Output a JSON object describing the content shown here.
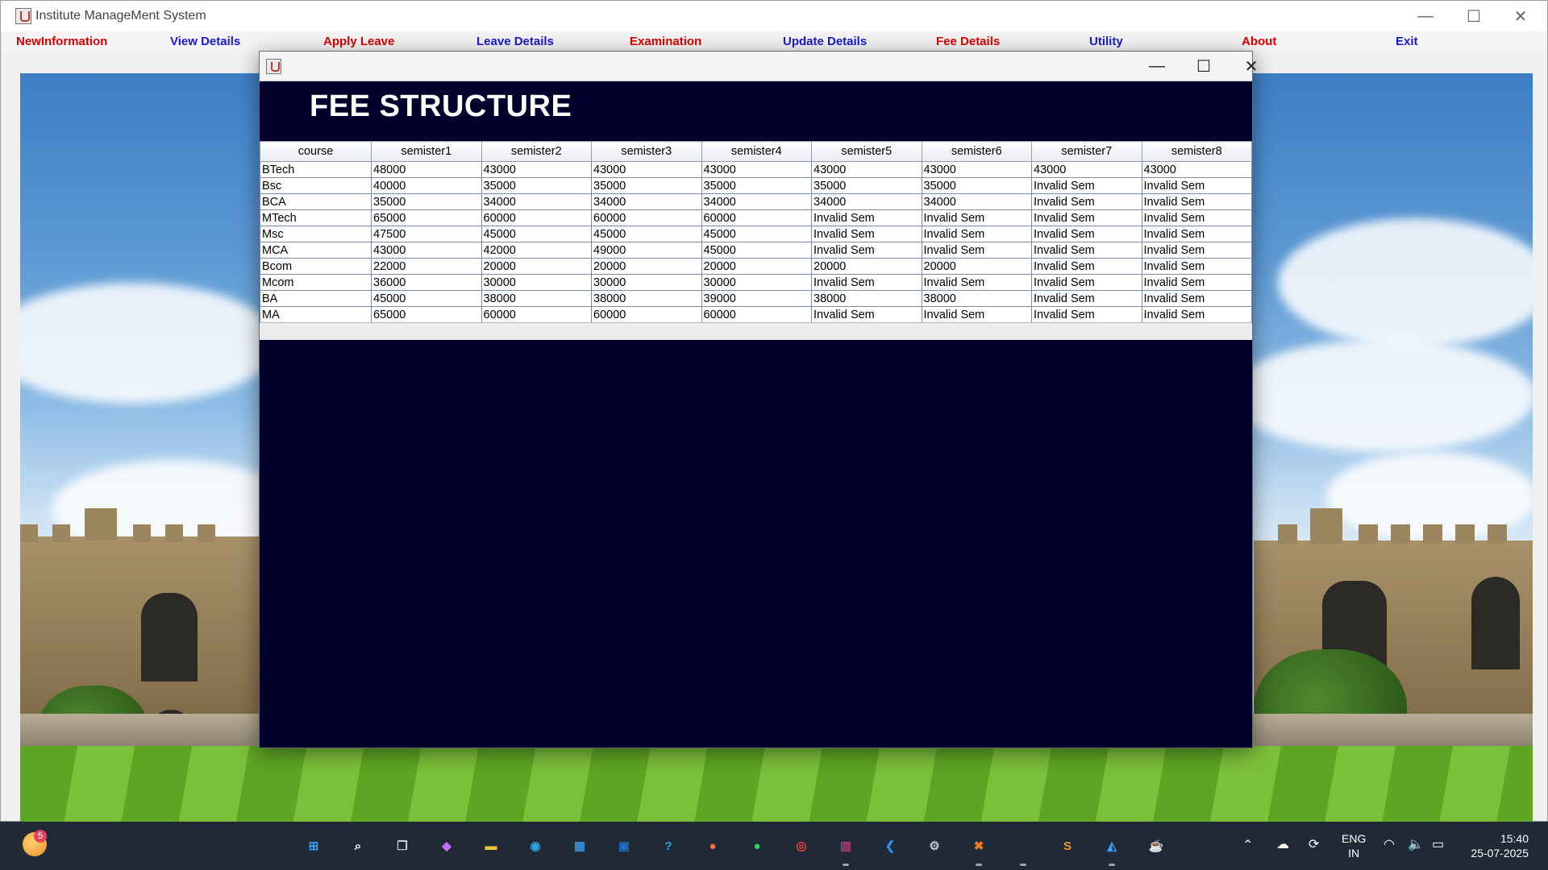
{
  "window": {
    "title": "Institute ManageMent System",
    "minimize_glyph": "—",
    "maximize_glyph": "☐",
    "close_glyph": "✕"
  },
  "menu": {
    "items": [
      {
        "label": "NewInformation",
        "color": "#e00000"
      },
      {
        "label": "View Details",
        "color": "#1a1ad6"
      },
      {
        "label": "Apply Leave",
        "color": "#e00000"
      },
      {
        "label": "Leave Details",
        "color": "#1a1ad6"
      },
      {
        "label": "Examination",
        "color": "#e00000"
      },
      {
        "label": "Update Details",
        "color": "#1a1ad6"
      },
      {
        "label": "Fee Details",
        "color": "#e00000"
      },
      {
        "label": "Utility",
        "color": "#1a1ad6"
      },
      {
        "label": "About",
        "color": "#e00000"
      },
      {
        "label": "Exit",
        "color": "#1a1ad6"
      }
    ]
  },
  "frame": {
    "heading": "FEE STRUCTURE",
    "background_color": "#00002a",
    "minimize_glyph": "—",
    "maximize_glyph": "☐",
    "close_glyph": "✕"
  },
  "table": {
    "columns": [
      "course",
      "semister1",
      "semister2",
      "semister3",
      "semister4",
      "semister5",
      "semister6",
      "semister7",
      "semister8"
    ],
    "rows": [
      [
        "BTech",
        "48000",
        "43000",
        "43000",
        "43000",
        "43000",
        "43000",
        "43000",
        "43000"
      ],
      [
        "Bsc",
        "40000",
        "35000",
        "35000",
        "35000",
        "35000",
        "35000",
        "Invalid Sem",
        "Invalid Sem"
      ],
      [
        "BCA",
        "35000",
        "34000",
        "34000",
        "34000",
        "34000",
        "34000",
        "Invalid Sem",
        "Invalid Sem"
      ],
      [
        "MTech",
        "65000",
        "60000",
        "60000",
        "60000",
        "Invalid Sem",
        "Invalid Sem",
        "Invalid Sem",
        "Invalid Sem"
      ],
      [
        "Msc",
        "47500",
        "45000",
        "45000",
        "45000",
        "Invalid Sem",
        "Invalid Sem",
        "Invalid Sem",
        "Invalid Sem"
      ],
      [
        "MCA",
        "43000",
        "42000",
        "49000",
        "45000",
        "Invalid Sem",
        "Invalid Sem",
        "Invalid Sem",
        "Invalid Sem"
      ],
      [
        "Bcom",
        "22000",
        "20000",
        "20000",
        "20000",
        "20000",
        "20000",
        "Invalid Sem",
        "Invalid Sem"
      ],
      [
        "Mcom",
        "36000",
        "30000",
        "30000",
        "30000",
        "Invalid Sem",
        "Invalid Sem",
        "Invalid Sem",
        "Invalid Sem"
      ],
      [
        "BA",
        "45000",
        "38000",
        "38000",
        "39000",
        "38000",
        "38000",
        "Invalid Sem",
        "Invalid Sem"
      ],
      [
        "MA",
        "65000",
        "60000",
        "60000",
        "60000",
        "Invalid Sem",
        "Invalid Sem",
        "Invalid Sem",
        "Invalid Sem"
      ]
    ]
  },
  "taskbar": {
    "notification_count": "5",
    "apps": [
      {
        "name": "start-icon",
        "glyph": "⊞",
        "color": "#3aa0ff"
      },
      {
        "name": "search-icon",
        "glyph": "⌕",
        "color": "#ffffff"
      },
      {
        "name": "task-view-icon",
        "glyph": "❐",
        "color": "#d0d0d0"
      },
      {
        "name": "copilot-icon",
        "glyph": "◆",
        "color": "#c76cff"
      },
      {
        "name": "file-explorer-icon",
        "glyph": "▬",
        "color": "#f3c33a"
      },
      {
        "name": "edge-icon",
        "glyph": "◉",
        "color": "#2aa6e0"
      },
      {
        "name": "store-icon",
        "glyph": "▦",
        "color": "#3a8fdc"
      },
      {
        "name": "myhp-icon",
        "glyph": "▣",
        "color": "#1c6fc2"
      },
      {
        "name": "help-icon",
        "glyph": "?",
        "color": "#2aa6e0"
      },
      {
        "name": "firefox-icon",
        "glyph": "●",
        "color": "#ff7139"
      },
      {
        "name": "spotify-icon",
        "glyph": "●",
        "color": "#1ed760"
      },
      {
        "name": "chrome-icon",
        "glyph": "◎",
        "color": "#e8453c"
      },
      {
        "name": "winrar-icon",
        "glyph": "▥",
        "color": "#b03a7a"
      },
      {
        "name": "vscode-icon",
        "glyph": "❮",
        "color": "#2f8ee0"
      },
      {
        "name": "settings-icon",
        "glyph": "⚙",
        "color": "#c0c8d0"
      },
      {
        "name": "xampp-icon",
        "glyph": "✖",
        "color": "#f47a20"
      },
      {
        "name": "terminal-icon",
        "glyph": "▶",
        "color": "#2c2c2c"
      },
      {
        "name": "sublime-icon",
        "glyph": "S",
        "color": "#f59b24"
      },
      {
        "name": "photos-icon",
        "glyph": "◭",
        "color": "#3a9ff0"
      },
      {
        "name": "java-icon",
        "glyph": "☕",
        "color": "#e7e7e7"
      }
    ],
    "tray": {
      "language_line1": "ENG",
      "language_line2": "IN",
      "time": "15:40",
      "date": "25-07-2025"
    }
  }
}
